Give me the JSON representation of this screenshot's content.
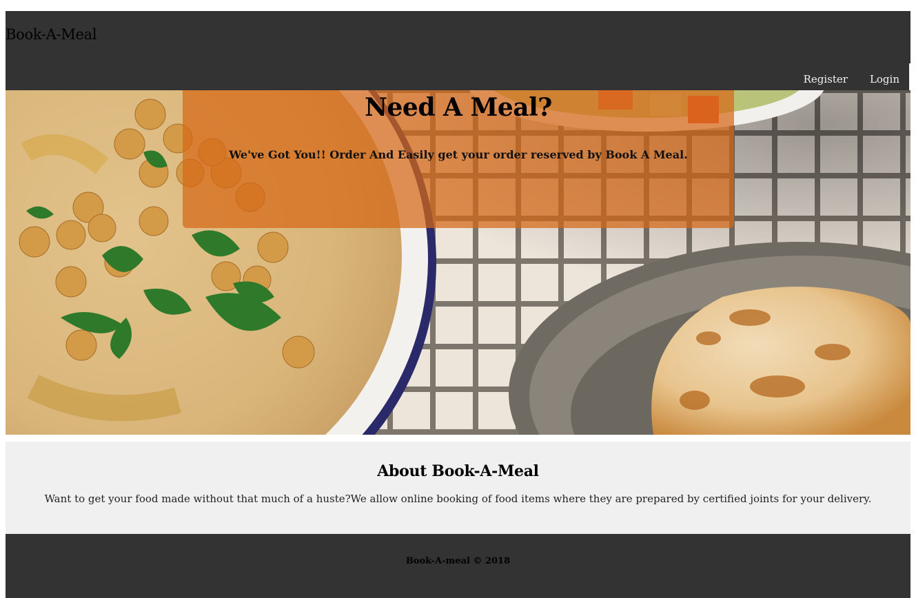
{
  "header": {
    "brand": "Book-A-Meal",
    "nav": {
      "register": "Register",
      "login": "Login"
    }
  },
  "hero": {
    "title": "Need A Meal?",
    "text": "We've Got You!! Order And Easily get your order reserved by Book A Meal.",
    "panel_color": "#d56816"
  },
  "about": {
    "title": "About Book-A-Meal",
    "text": "Want to get your food made without that much of a huste?We allow online booking of food items where they are prepared by certified joints for your delivery."
  },
  "footer": {
    "text": "Book-A-meal © 2018"
  },
  "colors": {
    "bar": "#333333",
    "about_bg": "#f0f0f0"
  }
}
